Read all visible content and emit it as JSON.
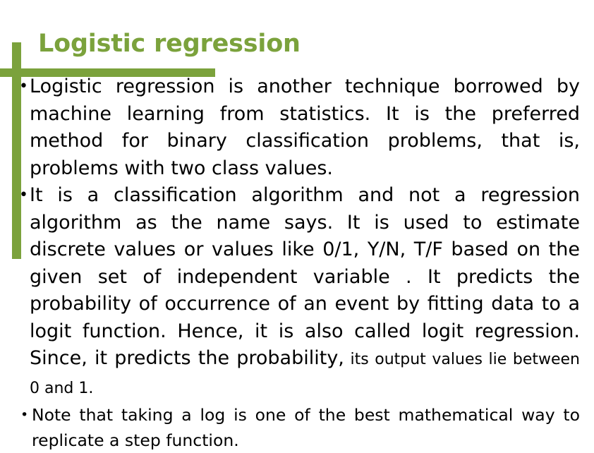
{
  "slide": {
    "title": "Logistic regression",
    "accent_color": "#7BA23C",
    "text_color": "#000000",
    "background_color": "#FFFFFF",
    "bullets": [
      {
        "id": "bullet-1",
        "text": "Logistic regression is another technique borrowed by machine learning from statistics. It is the preferred method for binary classification problems, that is, problems with two class values."
      },
      {
        "id": "bullet-2",
        "text_main": "It is a classification algorithm and not a regression algorithm as the name says. It is used to estimate discrete values or values like 0/1, Y/N, T/F based on the given set of independent variable . It predicts the probability of occurrence of an event by fitting data to a logit function. Hence, it is also called logit regression. Since, it predicts the probability,",
        "text_small": " its output values lie between 0 and 1."
      },
      {
        "id": "bullet-3",
        "text": "Note that taking a log is one of the best mathematical way to replicate a step function."
      }
    ]
  }
}
